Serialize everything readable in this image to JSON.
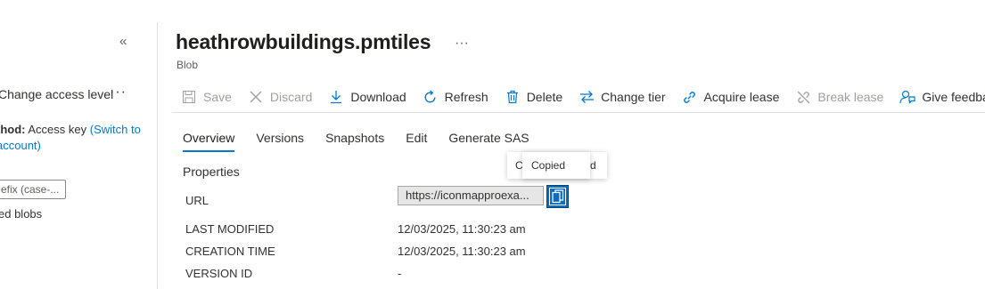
{
  "left_panel": {
    "collapse_icon": "double-chevron-left-icon",
    "change_access_label": "Change access level",
    "more_icon": "ellipsis-icon",
    "auth_method_label": "thod:",
    "auth_method_value": "Access key",
    "auth_switch_link_1": "(Switch to",
    "auth_switch_link_2": "account)",
    "prefix_placeholder": "efix (case-...",
    "deleted_blobs_label": "ed blobs"
  },
  "header": {
    "title": "heathrowbuildings.pmtiles",
    "subtitle": "Blob",
    "more_icon": "ellipsis-icon"
  },
  "toolbar": {
    "items": [
      {
        "label": "Save",
        "icon": "save-icon",
        "disabled": true
      },
      {
        "label": "Discard",
        "icon": "close-icon",
        "disabled": true
      },
      {
        "label": "Download",
        "icon": "download-icon",
        "disabled": false
      },
      {
        "label": "Refresh",
        "icon": "refresh-icon",
        "disabled": false
      },
      {
        "label": "Delete",
        "icon": "trash-icon",
        "disabled": false
      },
      {
        "label": "Change tier",
        "icon": "swap-icon",
        "disabled": false
      },
      {
        "label": "Acquire lease",
        "icon": "link-icon",
        "disabled": false
      },
      {
        "label": "Break lease",
        "icon": "broken-link-icon",
        "disabled": true
      },
      {
        "label": "Give feedback",
        "icon": "feedback-icon",
        "disabled": false
      }
    ]
  },
  "tabs": [
    {
      "label": "Overview",
      "active": true
    },
    {
      "label": "Versions",
      "active": false
    },
    {
      "label": "Snapshots",
      "active": false
    },
    {
      "label": "Edit",
      "active": false
    },
    {
      "label": "Generate SAS",
      "active": false
    }
  ],
  "properties": {
    "section_title": "Properties",
    "url_label": "URL",
    "url_value": "https://iconmapproexa...",
    "last_modified_label": "LAST MODIFIED",
    "last_modified_value": "12/03/2025, 11:30:23 am",
    "creation_time_label": "CREATION TIME",
    "creation_time_value": "12/03/2025, 11:30:23 am",
    "version_id_label": "VERSION ID",
    "version_id_value": "-"
  },
  "tooltip": {
    "behind_left": "Co",
    "behind_right": "rd",
    "copied": "Copied"
  },
  "colors": {
    "accent": "#0078d4",
    "copy_button": "#0f6cbd",
    "disabled_text": "#a19f9d"
  }
}
